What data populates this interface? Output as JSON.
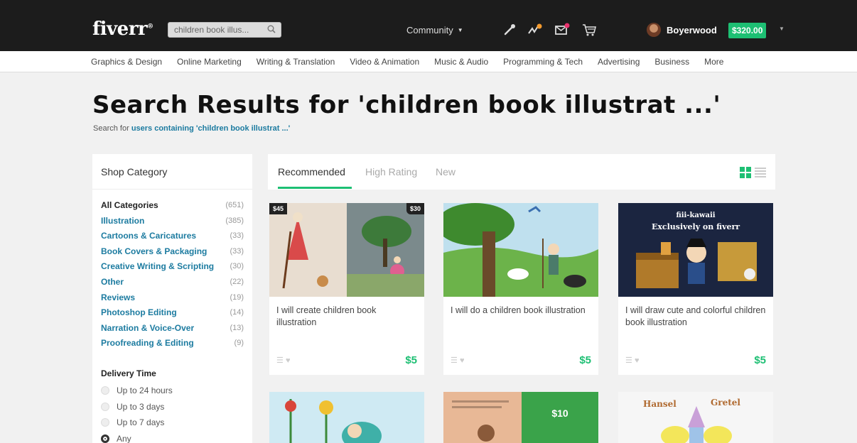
{
  "header": {
    "logo": "fiverr",
    "search_value": "children book illus...",
    "community_label": "Community",
    "username": "Boyerwood",
    "balance": "$320.00"
  },
  "categories_nav": [
    "Graphics & Design",
    "Online Marketing",
    "Writing & Translation",
    "Video & Animation",
    "Music & Audio",
    "Programming & Tech",
    "Advertising",
    "Business",
    "More"
  ],
  "page": {
    "title": "Search Results for 'children book illustrat ...'",
    "sub_prefix": "Search for ",
    "sub_link": "users containing 'children book illustrat ...'"
  },
  "sidebar": {
    "heading": "Shop Category",
    "categories": [
      {
        "name": "All Categories",
        "count": "(651)"
      },
      {
        "name": "Illustration",
        "count": "(385)"
      },
      {
        "name": "Cartoons & Caricatures",
        "count": "(33)"
      },
      {
        "name": "Book Covers & Packaging",
        "count": "(33)"
      },
      {
        "name": "Creative Writing & Scripting",
        "count": "(30)"
      },
      {
        "name": "Other",
        "count": "(22)"
      },
      {
        "name": "Reviews",
        "count": "(19)"
      },
      {
        "name": "Photoshop Editing",
        "count": "(14)"
      },
      {
        "name": "Narration & Voice-Over",
        "count": "(13)"
      },
      {
        "name": "Proofreading & Editing",
        "count": "(9)"
      }
    ],
    "delivery_heading": "Delivery Time",
    "delivery_options": [
      "Up to 24 hours",
      "Up to 3 days",
      "Up to 7 days",
      "Any"
    ],
    "delivery_selected": 3
  },
  "tabs": [
    "Recommended",
    "High Rating",
    "New"
  ],
  "gigs": [
    {
      "title": "I will create children book illustration",
      "price": "$5",
      "badge_left": "$45",
      "badge_right": "$30"
    },
    {
      "title": "I will do a children book illustration",
      "price": "$5"
    },
    {
      "title": "I will draw cute and colorful children book illustration",
      "price": "$5",
      "image_text_1": "fiii-kawaii",
      "image_text_2": "Exclusively on fiverr"
    }
  ],
  "gigs_row2": [
    {
      "image_text": ""
    },
    {
      "image_text": "$10"
    },
    {
      "image_text_1": "Hansel",
      "image_text_2": "Gretel"
    }
  ],
  "colors": {
    "accent": "#1dbf73",
    "link": "#1c7ba0",
    "topbar": "#1c1c1c"
  }
}
